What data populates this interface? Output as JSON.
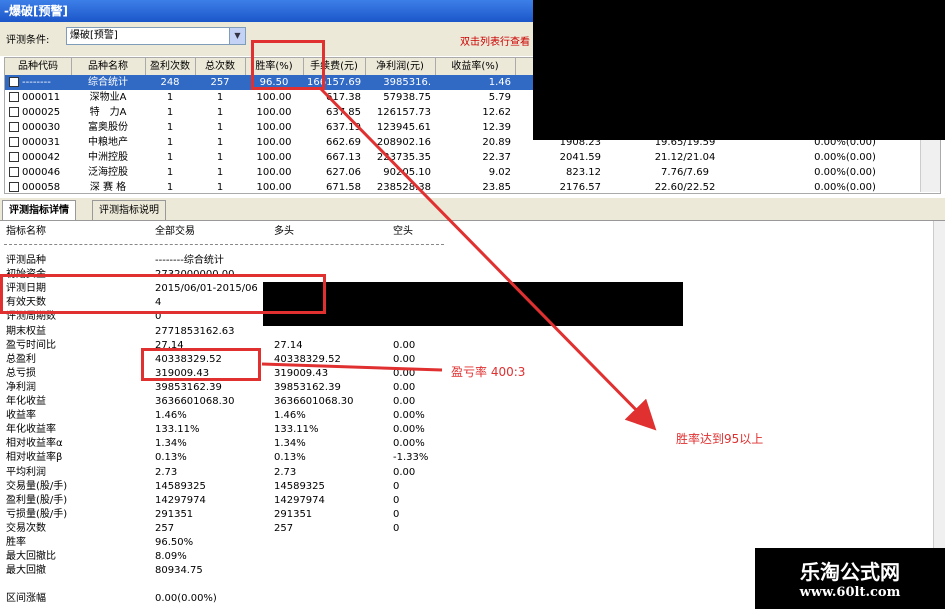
{
  "window": {
    "title": "-爆破[预警]"
  },
  "toolbar": {
    "filter_label": "评测条件:",
    "filter_value": "爆破[预警]",
    "hint": "双击列表行查看"
  },
  "table": {
    "headers": [
      "品种代码",
      "品种名称",
      "盈利次数",
      "总次数",
      "胜率(%)",
      "手续费(元)",
      "净利润(元)",
      "收益率(%)",
      "",
      "",
      ""
    ],
    "rows": [
      {
        "code": "--------",
        "name": "综合统计",
        "wins": "248",
        "total": "257",
        "winrate": "96.50",
        "fee": "166157.69",
        "profit": "3985316.",
        "ret": "1.46",
        "c9": "",
        "c10": "",
        "c11": "",
        "selected": true
      },
      {
        "code": "000011",
        "name": "深物业A",
        "wins": "1",
        "total": "1",
        "winrate": "100.00",
        "fee": "617.38",
        "profit": "57938.75",
        "ret": "5.79",
        "c9": "",
        "c10": "",
        "c11": ""
      },
      {
        "code": "000025",
        "name": "特　力A",
        "wins": "1",
        "total": "1",
        "winrate": "100.00",
        "fee": "637.85",
        "profit": "126157.73",
        "ret": "12.62",
        "c9": "",
        "c10": "",
        "c11": ""
      },
      {
        "code": "000030",
        "name": "富奥股份",
        "wins": "1",
        "total": "1",
        "winrate": "100.00",
        "fee": "637.19",
        "profit": "123945.61",
        "ret": "12.39",
        "c9": "",
        "c10": "",
        "c11": ""
      },
      {
        "code": "000031",
        "name": "中粮地产",
        "wins": "1",
        "total": "1",
        "winrate": "100.00",
        "fee": "662.69",
        "profit": "208902.16",
        "ret": "20.89",
        "c9": "1908.23",
        "c10": "19.65/19.59",
        "c11": "0.00%(0.00)"
      },
      {
        "code": "000042",
        "name": "中洲控股",
        "wins": "1",
        "total": "1",
        "winrate": "100.00",
        "fee": "667.13",
        "profit": "223735.35",
        "ret": "22.37",
        "c9": "2041.59",
        "c10": "21.12/21.04",
        "c11": "0.00%(0.00)"
      },
      {
        "code": "000046",
        "name": "泛海控股",
        "wins": "1",
        "total": "1",
        "winrate": "100.00",
        "fee": "627.06",
        "profit": "90205.10",
        "ret": "9.02",
        "c9": "823.12",
        "c10": "7.76/7.69",
        "c11": "0.00%(0.00)"
      },
      {
        "code": "000058",
        "name": "深 赛 格",
        "wins": "1",
        "total": "1",
        "winrate": "100.00",
        "fee": "671.58",
        "profit": "238528.38",
        "ret": "23.85",
        "c9": "2176.57",
        "c10": "22.60/22.52",
        "c11": "0.00%(0.00)"
      }
    ]
  },
  "tabs": [
    {
      "label": "评测指标详情",
      "active": true
    },
    {
      "label": "评测指标说明",
      "active": false
    }
  ],
  "detail": {
    "headers": [
      "指标名称",
      "全部交易",
      "多头",
      "空头"
    ],
    "rows": [
      [
        "评测品种",
        "--------综合统计",
        "",
        ""
      ],
      [
        "初始资金",
        "2732000000.00",
        "",
        ""
      ],
      [
        "评测日期",
        "2015/06/01-2015/06",
        "",
        ""
      ],
      [
        "有效天数",
        "4",
        "",
        ""
      ],
      [
        "评测周期数",
        "0",
        "",
        ""
      ],
      [
        "期末权益",
        "2771853162.63",
        "",
        ""
      ],
      [
        "盈亏时间比",
        "27.14",
        "27.14",
        "0.00"
      ],
      [
        "总盈利",
        "40338329.52",
        "40338329.52",
        "0.00"
      ],
      [
        "总亏损",
        "319009.43",
        "319009.43",
        "0.00"
      ],
      [
        "净利润",
        "39853162.39",
        "39853162.39",
        "0.00"
      ],
      [
        "年化收益",
        "3636601068.30",
        "3636601068.30",
        "0.00"
      ],
      [
        "收益率",
        "1.46%",
        "1.46%",
        "0.00%"
      ],
      [
        "年化收益率",
        "133.11%",
        "133.11%",
        "0.00%"
      ],
      [
        "相对收益率α",
        "1.34%",
        "1.34%",
        "0.00%"
      ],
      [
        "相对收益率β",
        "0.13%",
        "0.13%",
        "-1.33%"
      ],
      [
        "平均利润",
        "2.73",
        "2.73",
        "0.00"
      ],
      [
        "交易量(股/手)",
        "14589325",
        "14589325",
        "0"
      ],
      [
        "盈利量(股/手)",
        "14297974",
        "14297974",
        "0"
      ],
      [
        "亏损量(股/手)",
        "291351",
        "291351",
        "0"
      ],
      [
        "交易次数",
        "257",
        "257",
        "0"
      ],
      [
        "胜率",
        "96.50%",
        "",
        ""
      ],
      [
        "最大回撤比",
        "8.09%",
        "",
        ""
      ],
      [
        "最大回撤",
        "80934.75",
        "",
        ""
      ],
      [
        "",
        "",
        " ",
        ""
      ],
      [
        "区间涨幅",
        "0.00(0.00%)",
        "",
        ""
      ]
    ]
  },
  "annotations": {
    "ratio": "盈亏率 400:3",
    "winrate": "胜率达到95以上"
  },
  "brand": {
    "name": "乐淘公式网",
    "url": "www.60lt.com"
  },
  "colors": {
    "accent_red": "#e03030",
    "title_blue": "#1b56c9",
    "select_blue": "#316ac5"
  }
}
